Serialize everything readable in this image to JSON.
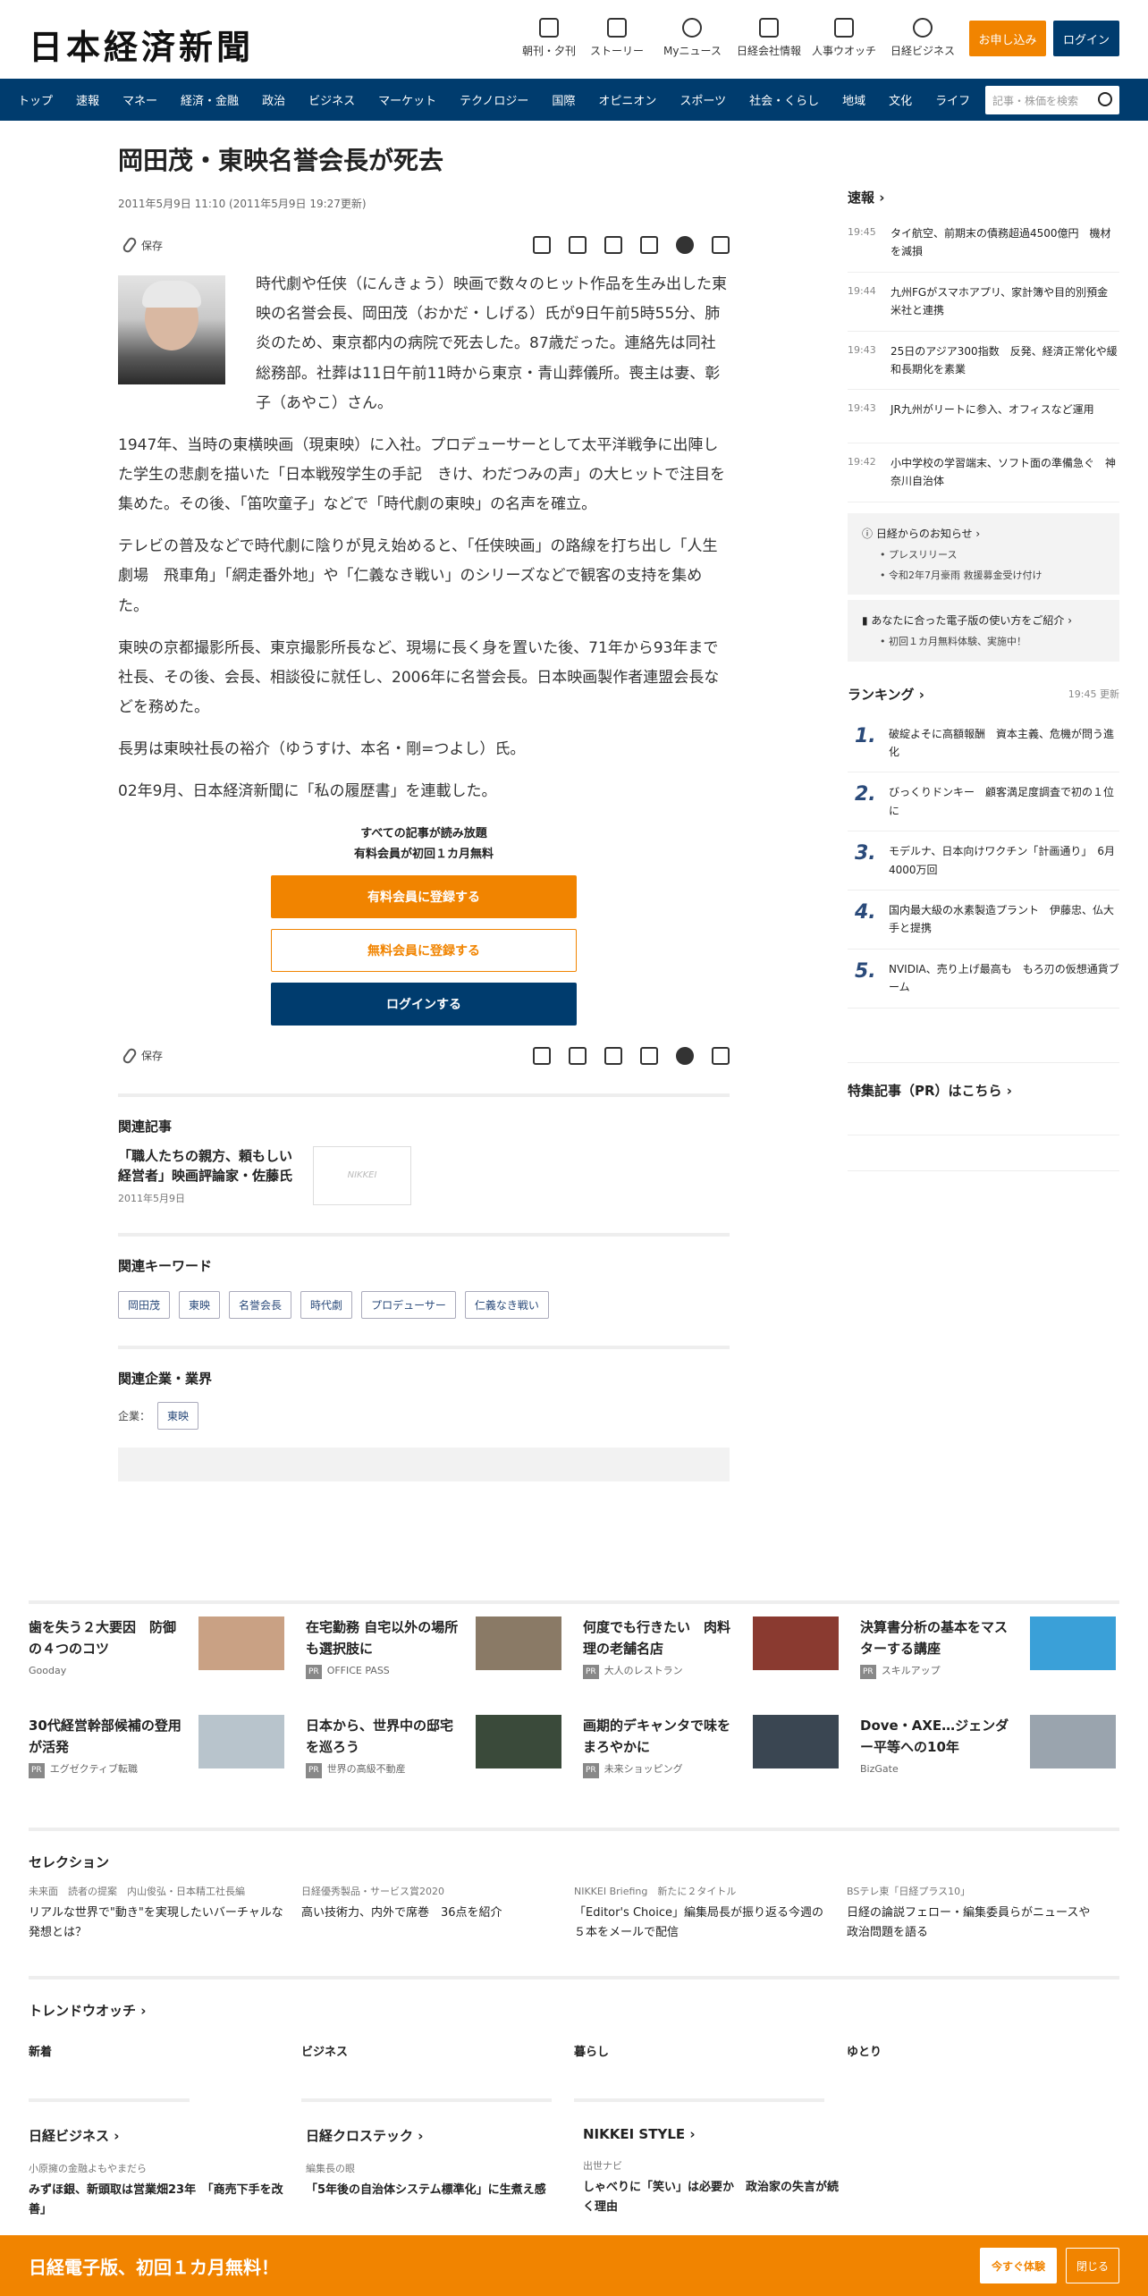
{
  "header": {
    "logo": "日本経済新聞",
    "nav": [
      "朝刊・夕刊",
      "ストーリー",
      "Myニュース",
      "日経会社情報",
      "人事ウオッチ",
      "日経ビジネス"
    ],
    "apply": "お申し込み",
    "login": "ログイン"
  },
  "global_nav": [
    "トップ",
    "速報",
    "マネー",
    "経済・金融",
    "政治",
    "ビジネス",
    "マーケット",
    "テクノロジー",
    "国際",
    "オピニオン",
    "スポーツ",
    "社会・くらし",
    "地域",
    "文化",
    "ライフ"
  ],
  "search": {
    "placeholder": "記事・株価を検索"
  },
  "article": {
    "title": "岡田茂・東映名誉会長が死去",
    "date": "2011年5月9日 11:10 (2011年5月9日 19:27更新)",
    "save": "保存",
    "lead": "時代劇や任侠（にんきょう）映画で数々のヒット作品を生み出した東映の名誉会長、岡田茂（おかだ・しげる）氏が9日午前5時55分、肺炎のため、東京都内の病院で死去した。87歳だった。連絡先は同社総務部。社葬は11日午前11時から東京・青山葬儀所。喪主は妻、彰子（あやこ）さん。",
    "paragraphs": [
      "1947年、当時の東横映画（現東映）に入社。プロデューサーとして太平洋戦争に出陣した学生の悲劇を描いた「日本戦歿学生の手記　きけ、わだつみの声」の大ヒットで注目を集めた。その後、「笛吹童子」などで「時代劇の東映」の名声を確立。",
      "テレビの普及などで時代劇に陰りが見え始めると、「任侠映画」の路線を打ち出し「人生劇場　飛車角」「網走番外地」や「仁義なき戦い」のシリーズなどで観客の支持を集めた。",
      "東映の京都撮影所長、東京撮影所長など、現場に長く身を置いた後、71年から93年まで社長、その後、会長、相談役に就任し、2006年に名誉会長。日本映画製作者連盟会長などを務めた。",
      "長男は東映社長の裕介（ゆうすけ、本名・剛=つよし）氏。",
      "02年9月、日本経済新聞に「私の履歴書」を連載した。"
    ]
  },
  "paywall": {
    "line1": "すべての記事が読み放題",
    "line2": "有料会員が初回１カ月無料",
    "paid": "有料会員に登録する",
    "free": "無料会員に登録する",
    "login": "ログインする"
  },
  "related": {
    "heading": "関連記事",
    "title": "「職人たちの親方、頼もしい経営者」映画評論家・佐藤氏",
    "date": "2011年5月9日",
    "thumb": "NIKKEI"
  },
  "keywords": {
    "heading": "関連キーワード",
    "items": [
      "岡田茂",
      "東映",
      "名誉会長",
      "時代劇",
      "プロデューサー",
      "仁義なき戦い"
    ]
  },
  "companies": {
    "heading": "関連企業・業界",
    "label": "企業：",
    "items": [
      "東映"
    ]
  },
  "sidebar": {
    "flash_heading": "速報",
    "flash": [
      {
        "time": "19:45",
        "text": "タイ航空、前期末の債務超過4500億円　機材を減損"
      },
      {
        "time": "19:44",
        "text": "九州FGがスマホアプリ、家計簿や目的別預金　米社と連携"
      },
      {
        "time": "19:43",
        "text": "25日のアジア300指数　反発、経済正常化や緩和長期化を素業"
      },
      {
        "time": "19:43",
        "text": "JR九州がリートに参入、オフィスなど運用"
      },
      {
        "time": "19:42",
        "text": "小中学校の学習端末、ソフト面の準備急ぐ　神奈川自治体"
      }
    ],
    "notice_heading": "日経からのお知らせ",
    "notices": [
      "プレスリリース",
      "令和2年7月豪雨 救援募金受け付け"
    ],
    "guide_heading": "あなたに合った電子版の使い方をご紹介",
    "guide": [
      "初回１カ月無料体験、実施中！"
    ],
    "ranking_heading": "ランキング",
    "ranking_time": "19:45  更新",
    "ranking": [
      "破綻よそに高額報酬　資本主義、危機が問う進化",
      "びっくりドンキー　顧客満足度調査で初の１位に",
      "モデルナ、日本向けワクチン「計画通り」　6月4000万回",
      "国内最大級の水素製造プラント　伊藤忠、仏大手と提携",
      "NVIDIA、売り上げ最高も　もろ刃の仮想通貨ブーム"
    ],
    "special": "特集記事（PR）はこちら"
  },
  "promo": [
    {
      "title": "歯を失う２大要因　防御の４つのコツ",
      "src": "Gooday",
      "pr": false,
      "color": "#c9a184"
    },
    {
      "title": "在宅勤務 自宅以外の場所も選択肢に",
      "src": "OFFICE PASS",
      "pr": true,
      "color": "#8a7a66"
    },
    {
      "title": "何度でも行きたい　肉料理の老舗名店",
      "src": "大人のレストラン",
      "pr": true,
      "color": "#8a3a30"
    },
    {
      "title": "決算書分析の基本をマスターする講座",
      "src": "スキルアップ",
      "pr": true,
      "color": "#3aa0d8"
    },
    {
      "title": "30代経営幹部候補の登用が活発",
      "src": "エグゼクティブ転職",
      "pr": true,
      "color": "#b8c4cc"
    },
    {
      "title": "日本から、世界中の邸宅を巡ろう",
      "src": "世界の高級不動産",
      "pr": true,
      "color": "#3a4a3a"
    },
    {
      "title": "画期的デキャンタで味をまろやかに",
      "src": "未来ショッピング",
      "pr": true,
      "color": "#3a4652"
    },
    {
      "title": "Dove・AXE…ジェンダー平等への10年",
      "src": "BizGate",
      "pr": false,
      "color": "#9aa4ae"
    }
  ],
  "selection": {
    "heading": "セレクション",
    "items": [
      {
        "src": "未来面　読者の提案　内山俊弘・日本精工社長編",
        "title": "リアルな世界で\"動き\"を実現したいバーチャルな発想とは？"
      },
      {
        "src": "日経優秀製品・サービス賞2020",
        "title": "高い技術力、内外で席巻　36点を紹介"
      },
      {
        "src": "NIKKEI Briefing　新たに２タイトル",
        "title": "「Editor's Choice」編集局長が振り返る今週の５本をメールで配信"
      },
      {
        "src": "BSテレ東「日経プラス10」",
        "title": "日経の論説フェロー・編集委員らがニュースや政治問題を語る"
      }
    ]
  },
  "trend": {
    "heading": "トレンドウオッチ",
    "items": [
      "新着",
      "ビジネス",
      "暮らし",
      "ゆとり"
    ]
  },
  "media": [
    {
      "heading": "日経ビジネス",
      "src": "小原擁の金融よもやまだら",
      "title": "みずほ銀、新頭取は営業畑23年　「商売下手を改善」"
    },
    {
      "heading": "日経クロステック",
      "src": "編集長の眼",
      "title": "「5年後の自治体システム標準化」に生煮え感"
    },
    {
      "heading": "NIKKEI STYLE",
      "src": "出世ナビ",
      "title": "しゃべりに「笑い」は必要か　政治家の失言が続く理由"
    }
  ],
  "footer": {
    "text": "日経電子版、初回１カ月無料！",
    "try": "今すぐ体験",
    "close": "閉じる"
  }
}
